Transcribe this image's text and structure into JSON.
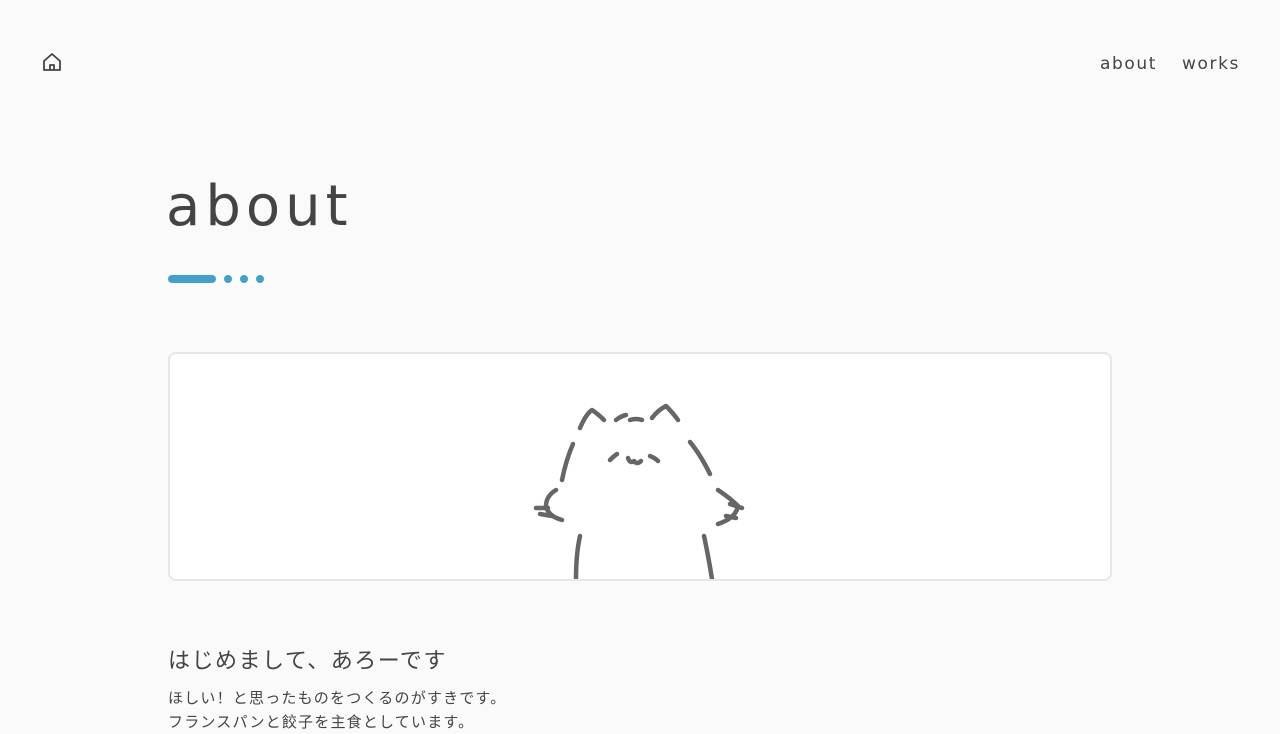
{
  "header": {
    "home_icon": "home-icon",
    "nav": [
      {
        "label": "about"
      },
      {
        "label": "works"
      }
    ]
  },
  "page": {
    "title": "about",
    "accent_color": "#44a0c9"
  },
  "hero": {
    "illustration": "cat-illustration"
  },
  "intro": {
    "heading": "はじめまして、あろーです",
    "lines": [
      "ほしい！と思ったものをつくるのがすきです。",
      "フランスパンと餃子を主食としています。"
    ]
  }
}
